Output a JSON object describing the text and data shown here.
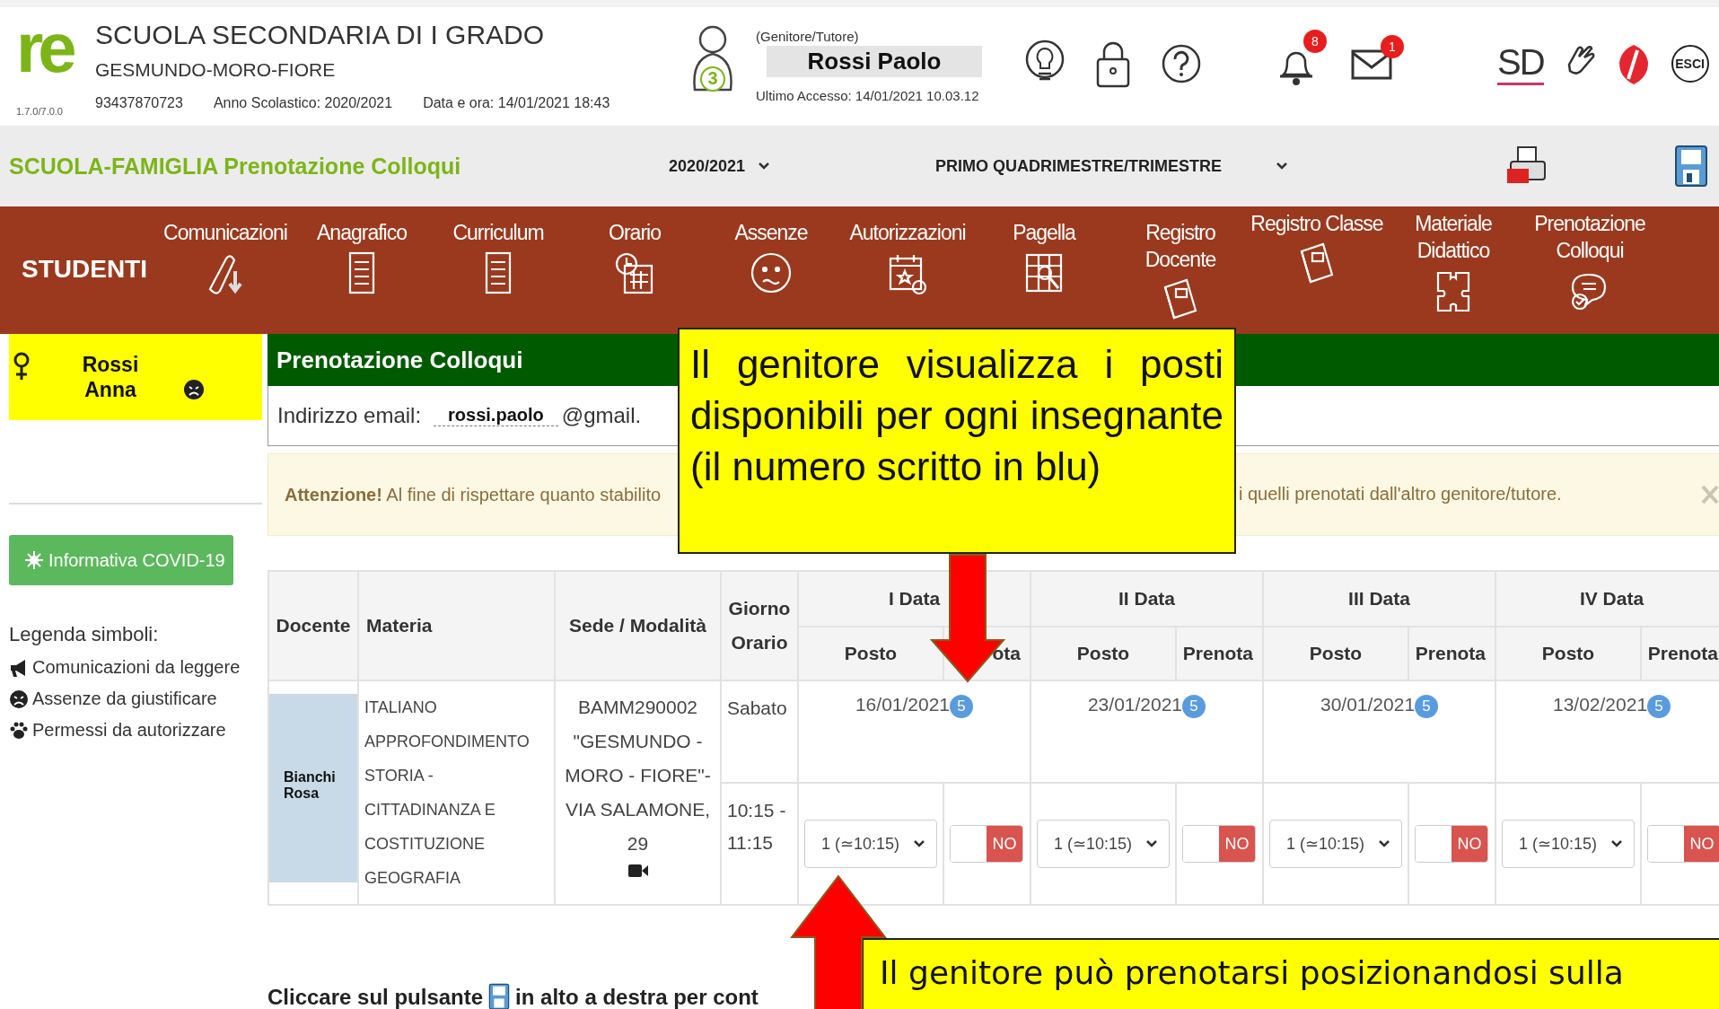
{
  "header": {
    "logo": "re",
    "version": "1.7.0/7.0.0",
    "school_name": "SCUOLA SECONDARIA DI I GRADO",
    "school_sub": "GESMUNDO-MORO-FIORE",
    "phone": "93437870723",
    "school_year": "Anno Scolastico: 2020/2021",
    "datetime": "Data e ora: 14/01/2021 18:43",
    "avatar_badge": "3",
    "user_role": "(Genitore/Tutore)",
    "user_name": "Rossi Paolo",
    "last_access": "Ultimo Accesso: 14/01/2021 10.03.12",
    "notifications": "8",
    "messages": "1",
    "brand": "SD",
    "logout": "ESCI"
  },
  "toolbar": {
    "title": "SCUOLA-FAMIGLIA Prenotazione Colloqui",
    "year": "2020/2021",
    "period": "PRIMO QUADRIMESTRE/TRIMESTRE"
  },
  "nav": {
    "section": "STUDENTI",
    "items": [
      {
        "label": "Comunicazioni",
        "kind": "scroll"
      },
      {
        "label": "Anagrafico",
        "kind": "document"
      },
      {
        "label": "Curriculum",
        "kind": "document"
      },
      {
        "label": "Orario",
        "kind": "schedule"
      },
      {
        "label": "Assenze",
        "kind": "face"
      },
      {
        "label": "Autorizzazioni",
        "kind": "calendar"
      },
      {
        "label": "Pagella",
        "kind": "grades"
      },
      {
        "label": "Registro Docente",
        "kind": "book"
      },
      {
        "label": "Registro Classe",
        "kind": "book"
      },
      {
        "label": "Materiale Didattico",
        "kind": "puzzle"
      },
      {
        "label": "Prenotazione Colloqui",
        "kind": "chat"
      }
    ]
  },
  "sidebar": {
    "student": "Rossi Anna",
    "covid_button": "Informativa COVID-19",
    "legend_title": "Legenda simboli:",
    "legend": [
      {
        "kind": "megaphone",
        "text": "Comunicazioni da leggere"
      },
      {
        "kind": "frown",
        "text": "Assenze da giustificare"
      },
      {
        "kind": "paw",
        "text": "Permessi da autorizzare"
      }
    ]
  },
  "panel": {
    "title": "Prenotazione Colloqui",
    "email_label": "Indirizzo email:",
    "email_user": "rossi.paolo",
    "email_domain": "@gmail.",
    "alert_strong": "Attenzione!",
    "alert_left": "Al fine di rispettare quanto stabilito",
    "alert_right": "i quelli prenotati dall'altro genitore/tutore."
  },
  "table": {
    "columns": [
      "Docente",
      "Materia",
      "Sede / Modalità",
      "Giorno Orario"
    ],
    "slots": [
      {
        "group": "I Data",
        "posto_label": "Posto",
        "prenota_label": "ota",
        "date": "16/01/2021",
        "available": "5",
        "choice": "1 (≃10:15)",
        "booked": false,
        "toggle": "NO"
      },
      {
        "group": "II Data",
        "posto_label": "Posto",
        "prenota_label": "Prenota",
        "date": "23/01/2021",
        "available": "5",
        "choice": "1 (≃10:15)",
        "booked": false,
        "toggle": "NO"
      },
      {
        "group": "III Data",
        "posto_label": "Posto",
        "prenota_label": "Prenota",
        "date": "30/01/2021",
        "available": "5",
        "choice": "1 (≃10:15)",
        "booked": false,
        "toggle": "NO"
      },
      {
        "group": "IV Data",
        "posto_label": "Posto",
        "prenota_label": "Prenota",
        "date": "13/02/2021",
        "available": "5",
        "choice": "1 (≃10:15)",
        "booked": false,
        "toggle": "NO"
      }
    ],
    "row": {
      "teacher": "Bianchi Rosa",
      "subjects": [
        "ITALIANO",
        "APPROFONDIMENTO",
        "STORIA - CITTADINANZA E COSTITUZIONE",
        "GEOGRAFIA"
      ],
      "venue": "BAMM290002 \"GESMUNDO - MORO - FIORE\"- VIA SALAMONE, 29",
      "day": "Sabato",
      "time": "10:15 - 11:15"
    }
  },
  "note": {
    "before": "Cliccare sul pulsante",
    "after": "in alto a destra per cont"
  },
  "callouts": [
    "Il genitore visualizza i posti disponibili per ogni insegnante (il numero scritto in blu)",
    "Il genitore può prenotarsi posizionandosi sulla"
  ]
}
